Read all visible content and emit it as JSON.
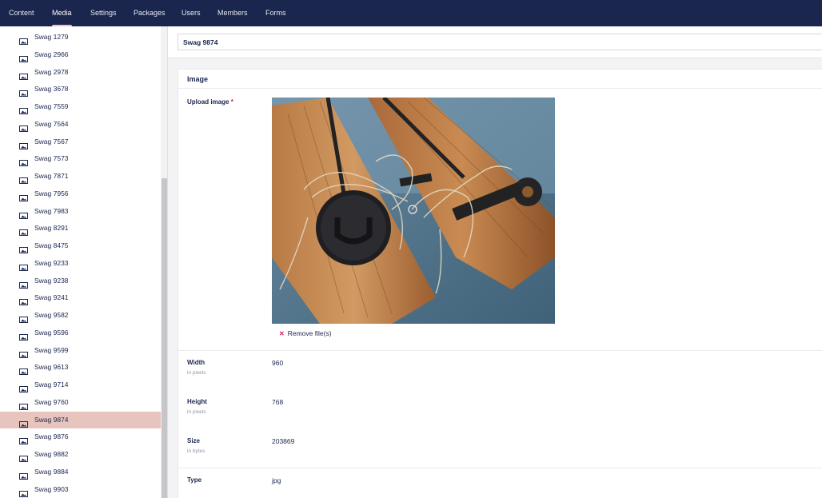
{
  "nav": {
    "items": [
      "Content",
      "Media",
      "Settings",
      "Packages",
      "Users",
      "Members",
      "Forms"
    ],
    "active": "Media"
  },
  "tree": {
    "items": [
      "Swag 1279",
      "Swag 2966",
      "Swag 2978",
      "Swag 3678",
      "Swag 7559",
      "Swag 7564",
      "Swag 7567",
      "Swag 7573",
      "Swag 7871",
      "Swag 7956",
      "Swag 7983",
      "Swag 8291",
      "Swag 8475",
      "Swag 9233",
      "Swag 9238",
      "Swag 9241",
      "Swag 9582",
      "Swag 9596",
      "Swag 9599",
      "Swag 9613",
      "Swag 9714",
      "Swag 9760",
      "Swag 9874",
      "Swag 9876",
      "Swag 9882",
      "Swag 9884",
      "Swag 9903"
    ],
    "selected": "Swag 9874",
    "item_icon": "image-icon"
  },
  "media": {
    "name": "Swag 9874",
    "group_title": "Image",
    "upload_label": "Upload image",
    "required_mark": "*",
    "remove_label": "Remove file(s)",
    "properties": {
      "width": {
        "label": "Width",
        "desc": "in pixels",
        "value": "960"
      },
      "height": {
        "label": "Height",
        "desc": "in pixels",
        "value": "768"
      },
      "size": {
        "label": "Size",
        "desc": "in bytes",
        "value": "203869"
      },
      "type": {
        "label": "Type",
        "value": "jpg"
      }
    }
  },
  "colors": {
    "header_bg": "#1b264f",
    "selected_row": "#e8c4bf",
    "active_tab_underline": "#f5c1bc",
    "required": "#d42054"
  }
}
